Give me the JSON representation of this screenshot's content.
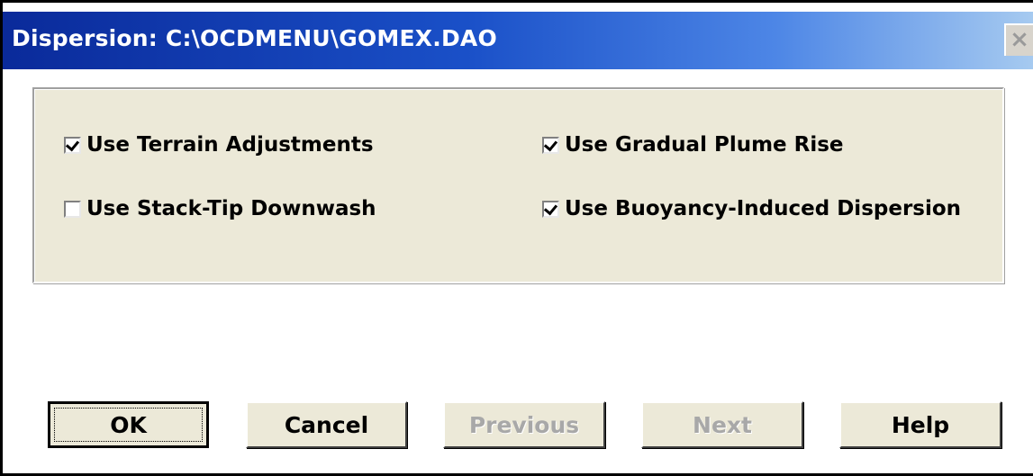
{
  "window": {
    "title": "Dispersion: C:\\OCDMENU\\GOMEX.DAO",
    "close_glyph": "×"
  },
  "options": {
    "terrain": {
      "label": "Use Terrain Adjustments",
      "checked": true
    },
    "plume": {
      "label": "Use Gradual Plume Rise",
      "checked": true
    },
    "stacktip": {
      "label": "Use Stack-Tip Downwash",
      "checked": false
    },
    "buoyancy": {
      "label": "Use Buoyancy-Induced Dispersion",
      "checked": true
    }
  },
  "buttons": {
    "ok": "OK",
    "cancel": "Cancel",
    "previous": "Previous",
    "next": "Next",
    "help": "Help"
  },
  "colors": {
    "title_gradient_start": "#0a2a9a",
    "title_gradient_end": "#a6caf0",
    "panel": "#ece9d8"
  }
}
